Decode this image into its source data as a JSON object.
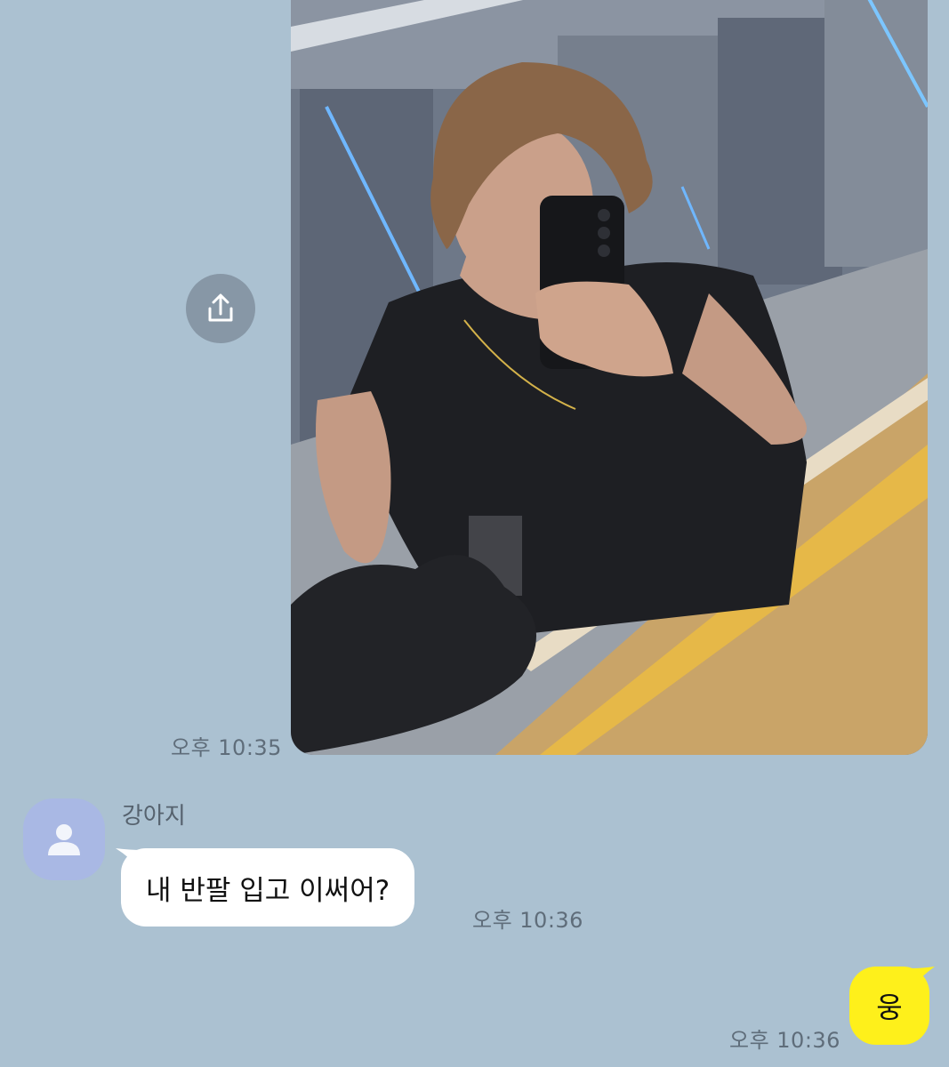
{
  "messages": {
    "photo": {
      "time": "오후 10:35"
    },
    "received": {
      "sender": "강아지",
      "text": "내 반팔 입고 이써어?",
      "time": "오후 10:36"
    },
    "sent": {
      "text": "웅",
      "time": "오후 10:36"
    }
  },
  "icons": {
    "share": "share-icon",
    "avatar": "person-icon"
  },
  "colors": {
    "chat_background": "#abc1d1",
    "sent_bubble": "#fef01b",
    "received_bubble": "#ffffff",
    "avatar_background": "#a9b8e4",
    "share_button": "#8797a6"
  }
}
